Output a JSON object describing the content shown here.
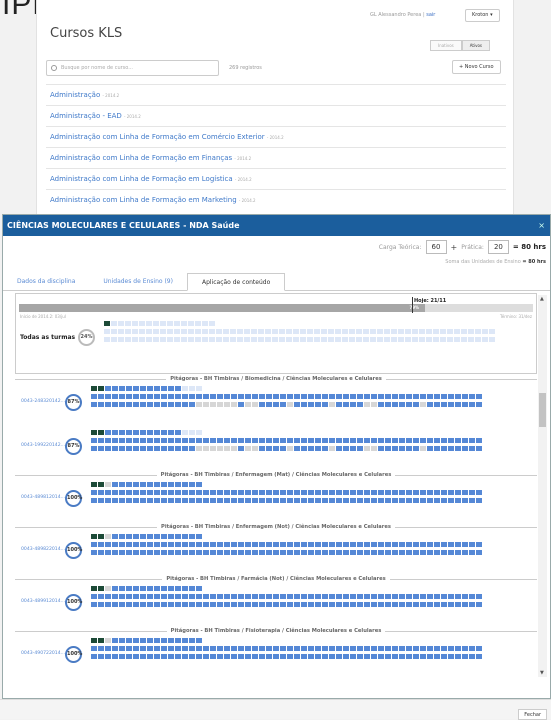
{
  "background": {
    "heading": "IPLINAS",
    "title": "Cursos KLS",
    "user_name": "GL Alessandro Perea",
    "sair": "sair",
    "brand_button": "Kroton",
    "tabs": [
      "Inativos",
      "Ativos"
    ],
    "search_placeholder": "Busque por nome de curso...",
    "records": "269 registros",
    "new_button": "+ Novo Curso",
    "courses": [
      {
        "name": "Administração",
        "year": "- 2014.2"
      },
      {
        "name": "Administração - EAD",
        "year": "- 2014.2"
      },
      {
        "name": "Administração com Linha de Formação em Comércio Exterior",
        "year": "- 2014.2"
      },
      {
        "name": "Administração com Linha de Formação em Finanças",
        "year": "- 2014.2"
      },
      {
        "name": "Administração com Linha de Formação em Logística",
        "year": "- 2014.2"
      },
      {
        "name": "Administração com Linha de Formação em Marketing",
        "year": "- 2014.2"
      }
    ]
  },
  "modal": {
    "title": "CIÊNCIAS MOLECULARES E CELULARES - NDA Saúde",
    "close": "×",
    "carga_label": "Carga Teórica:",
    "carga_teorica": "60",
    "plus": "+",
    "pratica_label": "Prática:",
    "pratica": "20",
    "total": "= 80 hrs",
    "soma_label": "Soma das Unidades de Ensino",
    "soma_value": "= 80 hrs",
    "tabs": [
      "Dados da disciplina",
      "Unidades de Ensino (9)",
      "Aplicação de conteúdo"
    ],
    "active_tab": 2,
    "progress": {
      "hoje": "Hoje: 21/11",
      "percent": "79%",
      "percent_value": 79,
      "start": "Início de 2014.2: 03/jul",
      "end": "Término: 31/dez"
    },
    "todas": {
      "label": "Todas as turmas",
      "percent": "24%"
    },
    "groups": [
      {
        "title": "Pitágoras - BH Timbiras / Biomedicina / Ciências Moleculares e Celulares",
        "turmas": [
          {
            "code": "0043-248320142...",
            "percent": "87%"
          },
          {
            "code": "0043-199220142...",
            "percent": "87%"
          }
        ]
      },
      {
        "title": "Pitágoras - BH Timbiras / Enfermagem (Mat) / Ciências Moleculares e Celulares",
        "turmas": [
          {
            "code": "0043-489812014...",
            "percent": "100%"
          }
        ]
      },
      {
        "title": "Pitágoras - BH Timbiras / Enfermagem (Not) / Ciências Moleculares e Celulares",
        "turmas": [
          {
            "code": "0043-489822014...",
            "percent": "100%"
          }
        ]
      },
      {
        "title": "Pitágoras - BH Timbiras / Farmácia (Not) / Ciências Moleculares e Celulares",
        "turmas": [
          {
            "code": "0043-489912014...",
            "percent": "100%"
          }
        ]
      },
      {
        "title": "Pitágoras - BH Timbiras / Fisioterapia / Ciências Moleculares e Celulares",
        "turmas": [
          {
            "code": "0043-490722014...",
            "percent": "100%"
          }
        ]
      }
    ],
    "fechar": "Fechar"
  }
}
